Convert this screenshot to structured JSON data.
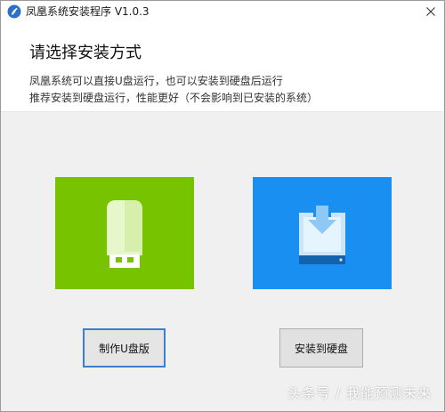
{
  "window": {
    "title": "凤凰系统安装程序 V1.0.3",
    "icon": "phoenix-logo-icon",
    "close_icon": "close-icon"
  },
  "header": {
    "heading": "请选择安装方式",
    "description_line1": "凤凰系统可以直接U盘运行，也可以安装到硬盘后运行",
    "description_line2": "推荐安装到硬盘运行，性能更好（不会影响到已安装的系统）"
  },
  "options": [
    {
      "id": "usb",
      "icon": "usb-drive-icon",
      "color": "#78c300",
      "button_label": "制作U盘版"
    },
    {
      "id": "disk",
      "icon": "hard-disk-download-icon",
      "color": "#1a8ff2",
      "button_label": "安装到硬盘"
    }
  ],
  "watermark": "头条号 / 我能预测未来"
}
